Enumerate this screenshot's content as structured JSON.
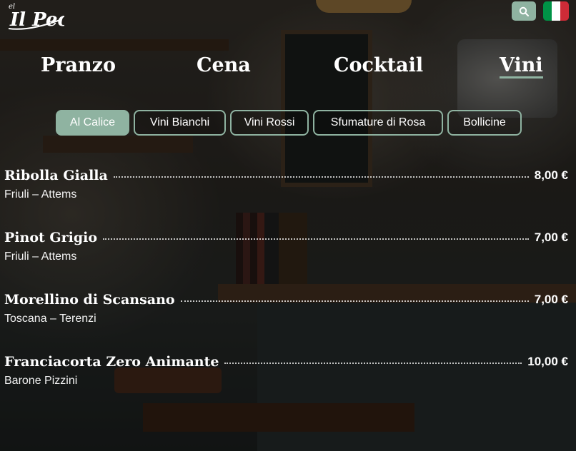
{
  "brand": {
    "logo_text": "Il Peca",
    "logo_small": "el"
  },
  "header": {
    "search_icon": "search-icon",
    "language_flag": "italy-flag-icon",
    "flag_colors": [
      "#009246",
      "#ffffff",
      "#ce2b37"
    ]
  },
  "nav": {
    "items": [
      "Pranzo",
      "Cena",
      "Cocktail",
      "Vini"
    ],
    "active": "Vini"
  },
  "tabs": {
    "items": [
      "Al Calice",
      "Vini Bianchi",
      "Vini Rossi",
      "Sfumature di Rosa",
      "Bollicine"
    ],
    "active": "Al Calice"
  },
  "menu": {
    "items": [
      {
        "name": "Ribolla Gialla",
        "price": "8,00 €",
        "origin": "Friuli – Attems"
      },
      {
        "name": "Pinot Grigio",
        "price": "7,00 €",
        "origin": "Friuli – Attems"
      },
      {
        "name": "Morellino di Scansano",
        "price": "7,00 €",
        "origin": "Toscana – Terenzi"
      },
      {
        "name": "Franciacorta Zero Animante",
        "price": "10,00 €",
        "origin": "Barone Pizzini"
      }
    ]
  },
  "colors": {
    "accent": "#8fb3a1",
    "text": "#ffffff"
  }
}
